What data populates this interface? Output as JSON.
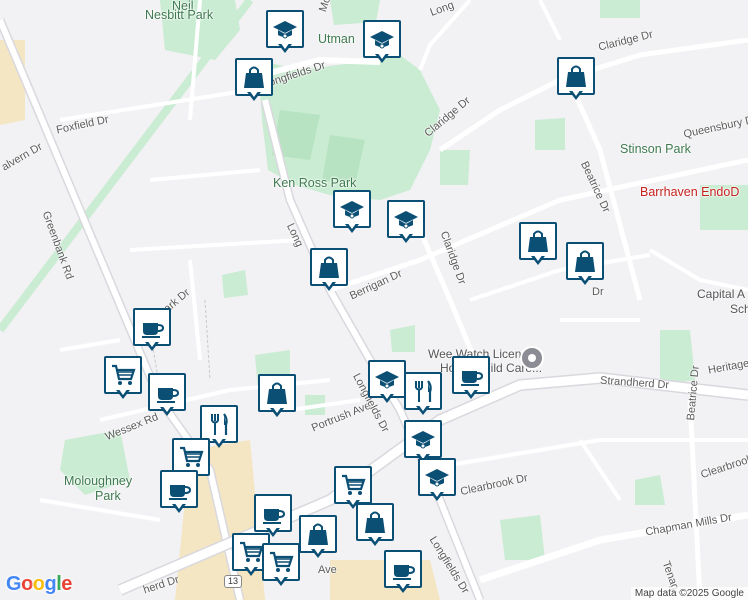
{
  "map": {
    "colors": {
      "background": "#f2f1f4",
      "park": "#c9ecd2",
      "commercial": "#f4e6c2",
      "road": "#ffffff",
      "road_major": "#e6e6eb",
      "marker_border": "#0b4f75",
      "marker_icon": "#0b4f75"
    },
    "labels": {
      "nesbitt_park_1": "Neil",
      "nesbitt_park_2": "Nesbitt Park",
      "mount": "Mount",
      "longfields_top": "Long",
      "utman": "Utman",
      "claridge_dr_top": "Claridge Dr",
      "longfields_dr": "Longfields Dr",
      "foxfield_dr": "Foxfield Dr",
      "malvern_dr": "alvern Dr",
      "greenbank_rd": "Greenbank Rd",
      "claridge_dr_mid": "Claridge Dr",
      "queensbury_dr": "Queensbury Dr",
      "stinson_park": "Stinson Park",
      "barrhaven_endo": "Barrhaven EndoD",
      "beatrice_dr_top": "Beatrice Dr",
      "ken_ross_park": "Ken Ross Park",
      "longfields_mid": "Long",
      "berrigan_dr": "Berrigan Dr",
      "claridge_dr_low": "Claridge Dr",
      "dr_fragment": "Dr",
      "capital_line1": "Capital A",
      "capital_line2": "Sch",
      "park_dr": "ry Park Dr",
      "wee_watch_1": "Wee Watch Licensed",
      "wee_watch_2": "Home Child Care...",
      "heritage": "Heritage",
      "strandherd_dr": "Strandherd Dr",
      "wessex_rd": "Wessex Rd",
      "portrush_ave": "Portrush Ave",
      "longfields_low": "Longfields Dr",
      "beatrice_dr_low": "Beatrice Dr",
      "clearbrook_dr_right": "Clearbrook",
      "moloughney_1": "Moloughney",
      "moloughney_2": "Park",
      "clearbrook_dr": "Clearbrook Dr",
      "chapman_mills": "Chapman Mills Dr",
      "tenago": "Tenag",
      "longfields_bottom": "Longfields Dr",
      "ave": "Ave",
      "herd_dr": "herd Dr",
      "route_13": "13"
    },
    "markers": [
      {
        "icon": "education-icon",
        "name": "school-marker-top-1"
      },
      {
        "icon": "education-icon",
        "name": "school-marker-utman"
      },
      {
        "icon": "shopping-bag-icon",
        "name": "shopping-marker-longfields"
      },
      {
        "icon": "shopping-bag-icon",
        "name": "shopping-marker-claridge"
      },
      {
        "icon": "education-icon",
        "name": "school-marker-ken-ross"
      },
      {
        "icon": "education-icon",
        "name": "school-marker-ken-ross-2"
      },
      {
        "icon": "shopping-bag-icon",
        "name": "shopping-marker-berrigan"
      },
      {
        "icon": "shopping-bag-icon",
        "name": "shopping-marker-stinson-1"
      },
      {
        "icon": "shopping-bag-icon",
        "name": "shopping-marker-stinson-2"
      },
      {
        "icon": "cafe-icon",
        "name": "cafe-marker-west"
      },
      {
        "icon": "cart-icon",
        "name": "grocery-marker-west"
      },
      {
        "icon": "cafe-icon",
        "name": "cafe-marker-wessex"
      },
      {
        "icon": "shopping-bag-icon",
        "name": "shopping-marker-wessex"
      },
      {
        "icon": "restaurant-icon",
        "name": "restaurant-marker-wessex"
      },
      {
        "icon": "shopping-bag-icon",
        "name": "shopping-marker-portrush"
      },
      {
        "icon": "cart-icon",
        "name": "grocery-marker-wessex"
      },
      {
        "icon": "cafe-icon",
        "name": "cafe-marker-moloughney"
      },
      {
        "icon": "education-icon",
        "name": "school-marker-strandherd"
      },
      {
        "icon": "restaurant-icon",
        "name": "restaurant-marker-strandherd"
      },
      {
        "icon": "cafe-icon",
        "name": "cafe-marker-strandherd"
      },
      {
        "icon": "education-icon",
        "name": "school-marker-longfields-low"
      },
      {
        "icon": "education-icon",
        "name": "school-marker-clearbrook"
      },
      {
        "icon": "cart-icon",
        "name": "grocery-marker-chapman"
      },
      {
        "icon": "shopping-bag-icon",
        "name": "shopping-marker-chapman"
      },
      {
        "icon": "cafe-icon",
        "name": "cafe-marker-south"
      },
      {
        "icon": "shopping-bag-icon",
        "name": "shopping-marker-south"
      },
      {
        "icon": "cart-icon",
        "name": "grocery-marker-south-1"
      },
      {
        "icon": "cart-icon",
        "name": "grocery-marker-south-2"
      },
      {
        "icon": "cafe-icon",
        "name": "cafe-marker-bottom"
      }
    ],
    "wee_watch_pin_icon": "location-pin-icon",
    "google_logo": "Google",
    "attribution": "Map data ©2025 Google"
  }
}
